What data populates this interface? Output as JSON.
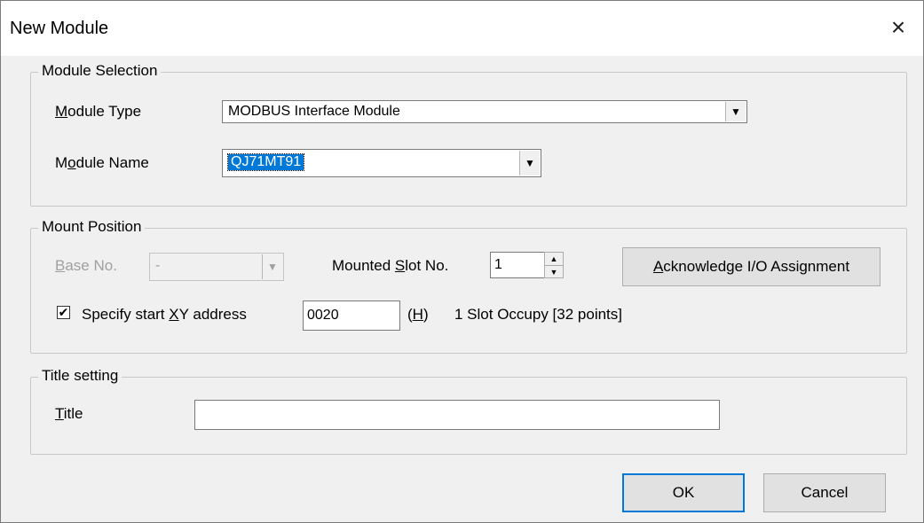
{
  "window": {
    "title": "New Module",
    "close_glyph": "×"
  },
  "module_selection": {
    "legend": "Module Selection",
    "type_label_pre": "",
    "type_label_mn": "M",
    "type_label_post": "odule Type",
    "type_value": "MODBUS Interface Module",
    "name_label_pre": "M",
    "name_label_mn": "o",
    "name_label_post": "dule Name",
    "name_value": "QJ71MT91"
  },
  "mount_position": {
    "legend": "Mount Position",
    "base_label_mn": "B",
    "base_label_post": "ase No.",
    "base_value": "-",
    "slot_label_pre": "Mounted ",
    "slot_label_mn": "S",
    "slot_label_post": "lot No.",
    "slot_value": "1",
    "ack_btn_mn": "A",
    "ack_btn_post": "cknowledge I/O Assignment",
    "specify_pre": "Specify start ",
    "specify_mn": "X",
    "specify_post": "Y address",
    "specify_checked": true,
    "check_glyph": "✔",
    "xy_value": "0020",
    "hex_open": "(",
    "hex_mn": "H",
    "hex_close": ")",
    "occupy_text": "1 Slot Occupy [32 points]"
  },
  "title_setting": {
    "legend": "Title setting",
    "title_label_mn": "T",
    "title_label_post": "itle",
    "title_value": ""
  },
  "buttons": {
    "ok": "OK",
    "cancel": "Cancel"
  },
  "icons": {
    "dropdown": "▼",
    "spin_up": "▲",
    "spin_down": "▼"
  }
}
